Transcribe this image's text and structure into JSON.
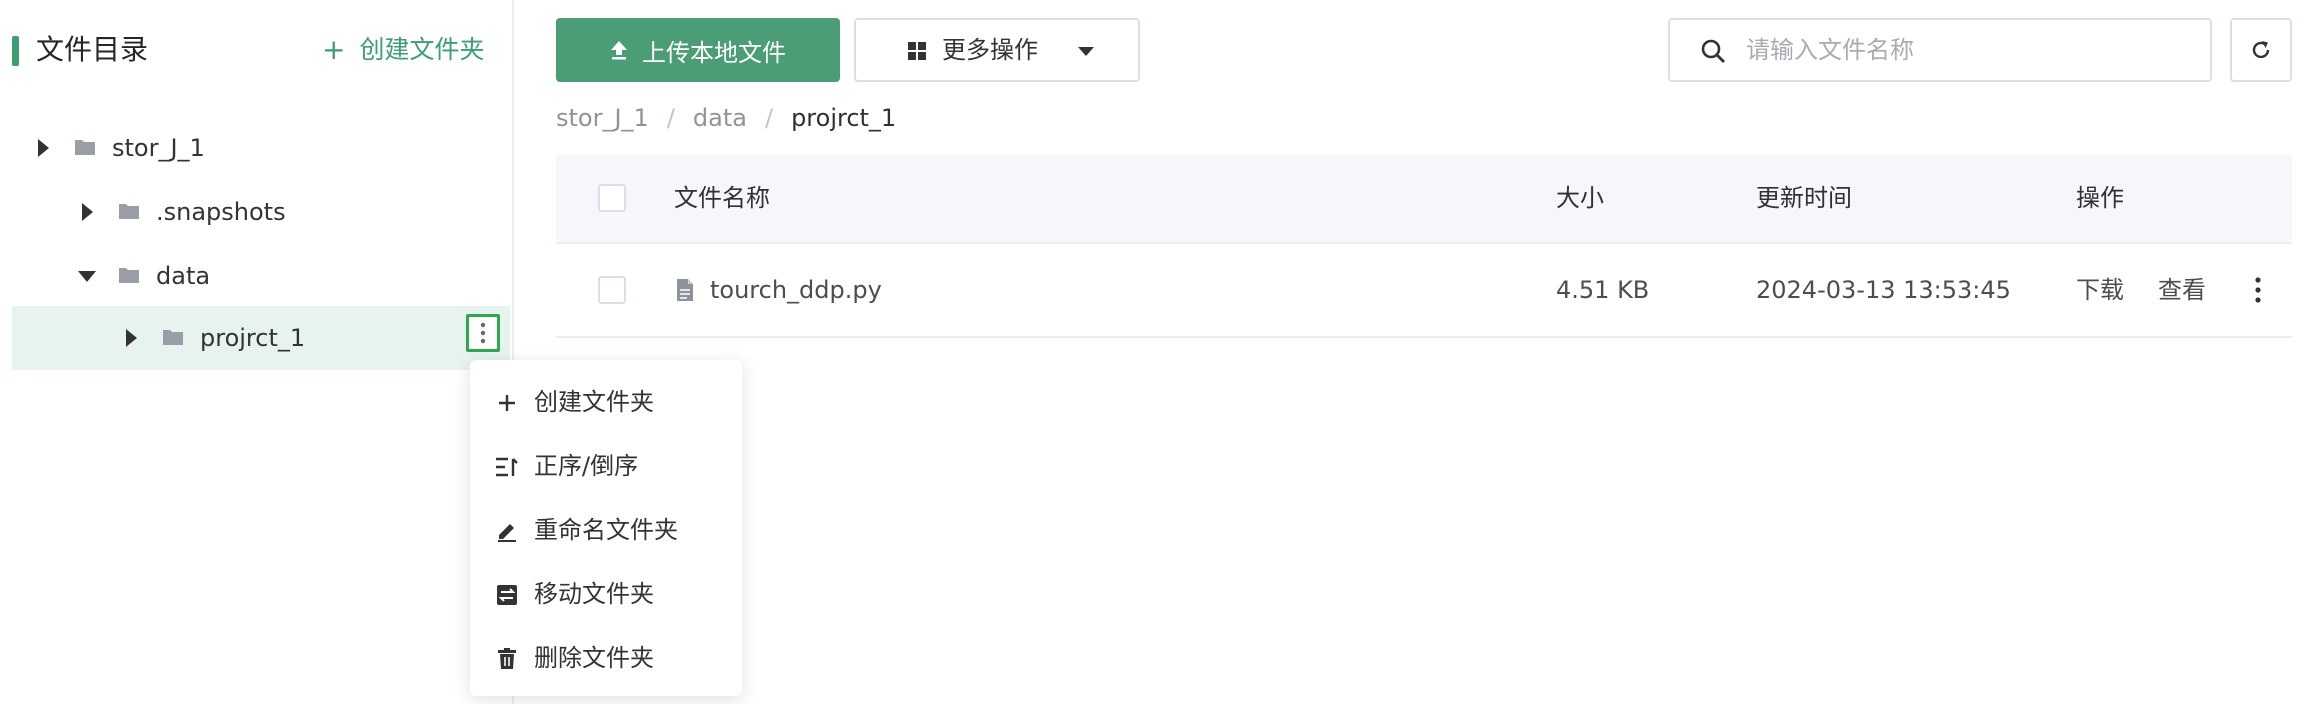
{
  "sidebar": {
    "title": "文件目录",
    "create_folder_label": "创建文件夹",
    "tree": [
      {
        "label": "stor_J_1",
        "expanded": false
      },
      {
        "label": ".snapshots",
        "expanded": false
      },
      {
        "label": "data",
        "expanded": true
      },
      {
        "label": "projrct_1",
        "expanded": false,
        "selected": true
      }
    ]
  },
  "context_menu": {
    "items": [
      {
        "label": "创建文件夹",
        "icon": "plus-icon"
      },
      {
        "label": "正序/倒序",
        "icon": "sort-icon"
      },
      {
        "label": "重命名文件夹",
        "icon": "pencil-icon"
      },
      {
        "label": "移动文件夹",
        "icon": "move-icon"
      },
      {
        "label": "删除文件夹",
        "icon": "trash-icon"
      }
    ]
  },
  "toolbar": {
    "upload_label": "上传本地文件",
    "more_label": "更多操作"
  },
  "search": {
    "placeholder": "请输入文件名称",
    "value": ""
  },
  "breadcrumb": [
    "stor_J_1",
    "data",
    "projrct_1"
  ],
  "table": {
    "columns": {
      "name": "文件名称",
      "size": "大小",
      "updated": "更新时间",
      "actions": "操作"
    },
    "rows": [
      {
        "name": "tourch_ddp.py",
        "size": "4.51 KB",
        "updated": "2024-03-13 13:53:45",
        "download_label": "下载",
        "view_label": "查看"
      }
    ]
  },
  "colors": {
    "accent_green": "#3d9e72",
    "upload_button": "#4a9d74",
    "selected_row": "#e6f3ee",
    "link_blue": "#3a78c2",
    "highlight_border": "#2fa84f"
  }
}
